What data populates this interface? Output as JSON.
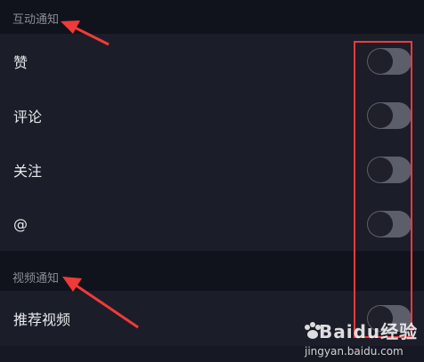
{
  "sections": {
    "interaction": {
      "title": "互动通知",
      "items": [
        {
          "label": "赞",
          "enabled": false
        },
        {
          "label": "评论",
          "enabled": false
        },
        {
          "label": "关注",
          "enabled": false
        },
        {
          "label": "@",
          "enabled": false
        }
      ]
    },
    "video": {
      "title": "视频通知",
      "items": [
        {
          "label": "推荐视频",
          "enabled": false
        }
      ]
    }
  },
  "watermark": {
    "logo": "Baidu经验",
    "url": "jingyan.baidu.com"
  },
  "colors": {
    "background": "#161823",
    "toggle_off": "#5c5e6a",
    "annotation": "#f03a3a"
  }
}
